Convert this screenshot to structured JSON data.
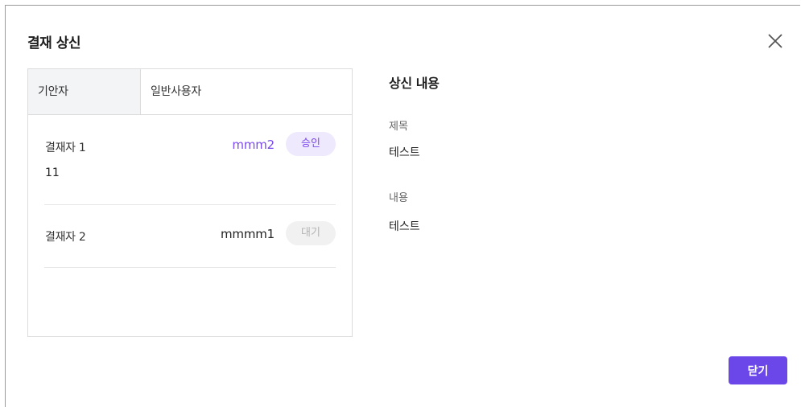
{
  "modal": {
    "title": "결재 상신",
    "close_icon": "close-icon"
  },
  "approval_line": {
    "drafter_label": "기안자",
    "drafter_value": "일반사용자",
    "approvers": [
      {
        "label": "결재자 1",
        "user": "mmm2",
        "status": "승인",
        "status_type": "approved",
        "comment": "11"
      },
      {
        "label": "결재자 2",
        "user": "mmmm1",
        "status": "대기",
        "status_type": "waiting",
        "comment": ""
      }
    ]
  },
  "content": {
    "section_title": "상신 내용",
    "subject_label": "제목",
    "subject_value": "테스트",
    "body_label": "내용",
    "body_value": "테스트"
  },
  "footer": {
    "close_label": "닫기"
  },
  "colors": {
    "accent": "#6b46e8",
    "approved_bg": "#efe9fd",
    "approved_text": "#7b4af0",
    "waiting_bg": "#f1f1f1",
    "waiting_text": "#b4b4b4"
  }
}
